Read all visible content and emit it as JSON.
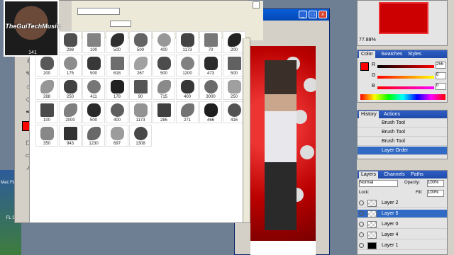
{
  "avatar": {
    "text": "TheGuiTechMusic",
    "number": "141"
  },
  "brush_numbers": [
    "298",
    "298",
    "100",
    "500",
    "500",
    "400",
    "1173",
    "70",
    "200",
    "200",
    "175",
    "500",
    "618",
    "267",
    "500",
    "1200",
    "473",
    "500",
    "288",
    "250",
    "411",
    "178",
    "90",
    "715",
    "400",
    "3000",
    "250",
    "100",
    "2000",
    "500",
    "400",
    "1173",
    "285",
    "271",
    "466",
    "416",
    "350",
    "943",
    "1230",
    "697",
    "1308"
  ],
  "desktop": {
    "labels": [
      "Mac Flash",
      "FL S"
    ]
  },
  "doc_window": {
    "buttons": [
      "_",
      "□",
      "×"
    ]
  },
  "navigator": {
    "zoom": "77.88%"
  },
  "color": {
    "tabs": [
      "Color",
      "Swatches",
      "Styles"
    ],
    "labels": [
      "R",
      "G",
      "B"
    ],
    "values": [
      "255",
      "0",
      "0"
    ],
    "fg": "#ff0000"
  },
  "history": {
    "tabs": [
      "History",
      "Actions"
    ],
    "items": [
      "Brush Tool",
      "Brush Tool",
      "Brush Tool",
      "Layer Order"
    ]
  },
  "layers": {
    "tabs": [
      "Layers",
      "Channels",
      "Paths"
    ],
    "blend": "Normal",
    "opacity_label": "Opacity:",
    "opacity": "100%",
    "lock_label": "Lock:",
    "fill_label": "Fill:",
    "fill": "100%",
    "items": [
      "Layer 2",
      "Layer 5",
      "Layer 0",
      "Layer 4",
      "Layer 1"
    ]
  },
  "colors": {
    "accent": "#316ac5",
    "red": "#ff0000"
  }
}
